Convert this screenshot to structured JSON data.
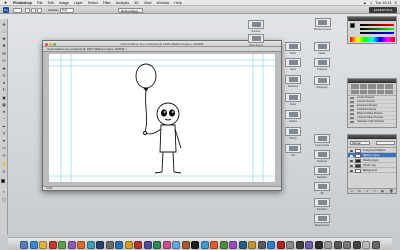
{
  "menubar": {
    "apple": "",
    "items": [
      "Photoshop",
      "File",
      "Edit",
      "Image",
      "Layer",
      "Select",
      "Filter",
      "Analysis",
      "3D",
      "View",
      "Window",
      "Help"
    ],
    "clock": "Tue 19:13"
  },
  "options_bar": {
    "feather": "0 px",
    "refine_edge": "Refine Edge...",
    "workspace": "ESSENTIALS"
  },
  "document": {
    "title": "Ghost balloon boy small.psd @ 100% (Balloon Figure, RGB/8)",
    "tab": "Ghost balloon boy small.psd @ 100% (Balloon Figure, RGB/8) ×",
    "status": "100%"
  },
  "right_collapsed": {
    "col1": [
      "Brushes",
      "Clone Source",
      "Paths",
      "Styles",
      "Swatches",
      "Notes",
      "Actions",
      "History",
      "Info"
    ],
    "col2": [
      "Brushes presets",
      "Masks",
      "Character",
      "Paragraph",
      "Layer comps",
      "Channels",
      "Navigator",
      "3D",
      "Animation",
      "Measurement"
    ]
  },
  "adjustments": {
    "items": [
      "Levels Presets",
      "Curves Presets",
      "Exposure Presets",
      "Hue/Sat Presets",
      "Black & White Presets",
      "Channel Mixer Presets",
      "Selective Color Presets"
    ]
  },
  "layers": {
    "blend_mode": "Normal",
    "rows": [
      {
        "name": "Foreground Balloon",
        "selected": false
      },
      {
        "name": "Balloon Figure",
        "selected": true
      },
      {
        "name": "Shadow layer",
        "selected": false
      },
      {
        "name": "Ghost copy",
        "selected": false
      },
      {
        "name": "Background",
        "selected": false
      }
    ]
  },
  "colors": {
    "accent": "#3d6fbf",
    "foreground_swatch": "#000000",
    "background_swatch": "#ffffff"
  },
  "dock": {
    "app_colors": [
      "#4f7fc9",
      "#3b88d8",
      "#e0b33c",
      "#c23b2a",
      "#5aa24a",
      "#8d5bb8",
      "#d96c2c",
      "#3c9fb6",
      "#27426b",
      "#6c6c6c",
      "#2b6eb6",
      "#d0a020",
      "#b8322f",
      "#4c4c9e",
      "#2d8a55",
      "#cf4f8a",
      "#6aa6e0",
      "#a45c2a",
      "#1f1f1f",
      "#3d9ad1",
      "#e05b2f",
      "#4e8c3a",
      "#9a4ac1",
      "#22617f",
      "#c59333",
      "#5b5b5b",
      "#2c7dd5",
      "#b42222",
      "#8a8a8a",
      "#3f3f3f",
      "#6f5ab0",
      "#2e2e2e",
      "#999999",
      "#555555",
      "#777777",
      "#444444",
      "#bbbbbb",
      "#666666"
    ]
  }
}
